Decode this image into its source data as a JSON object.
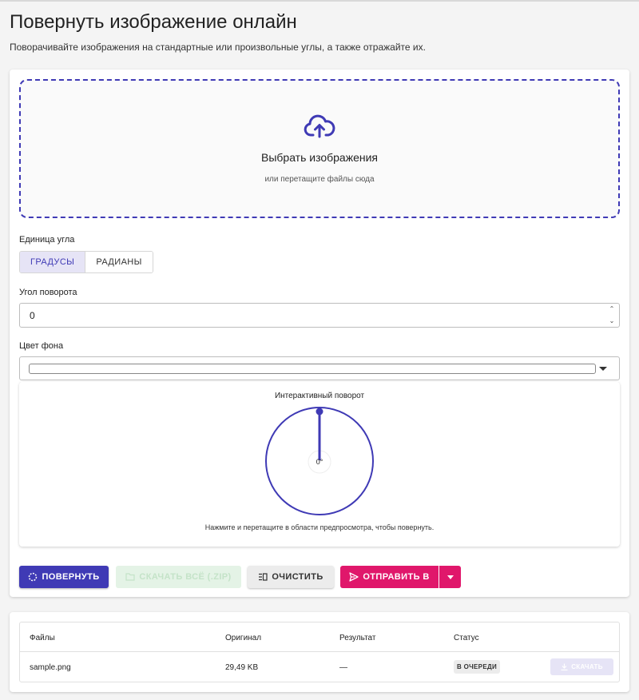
{
  "header": {
    "title": "Повернуть изображение онлайн",
    "subtitle": "Поворачивайте изображения на стандартные или произвольные углы, а также отражайте их."
  },
  "dropzone": {
    "icon": "cloud-upload-icon",
    "title": "Выбрать изображения",
    "hint": "или перетащите файлы сюда"
  },
  "angle_unit": {
    "label": "Единица угла",
    "options": [
      "ГРАДУСЫ",
      "РАДИАНЫ"
    ],
    "selected": "ГРАДУСЫ"
  },
  "rotation_angle": {
    "label": "Угол поворота",
    "value": "0"
  },
  "background_color": {
    "label": "Цвет фона",
    "value": "#ffffff"
  },
  "preview": {
    "title": "Интерактивный поворот",
    "angle_readout": "0°",
    "hint": "Нажмите и перетащите в области предпросмотра, чтобы повернуть."
  },
  "actions": {
    "rotate": "ПОВЕРНУТЬ",
    "download_zip": "СКАЧАТЬ ВСЁ (.ZIP)",
    "clear": "ОЧИСТИТЬ",
    "send_to": "ОТПРАВИТЬ В"
  },
  "files_table": {
    "columns": [
      "Файлы",
      "Оригинал",
      "Результат",
      "Статус"
    ],
    "rows": [
      {
        "name": "sample.png",
        "original": "29,49 KB",
        "result": "—",
        "status": "В ОЧЕРЕДИ",
        "action": "СКАЧАТЬ"
      }
    ]
  },
  "colors": {
    "primary": "#3f3ab5",
    "accent": "#e0176b",
    "success_disabled": "#e4f3e6"
  }
}
